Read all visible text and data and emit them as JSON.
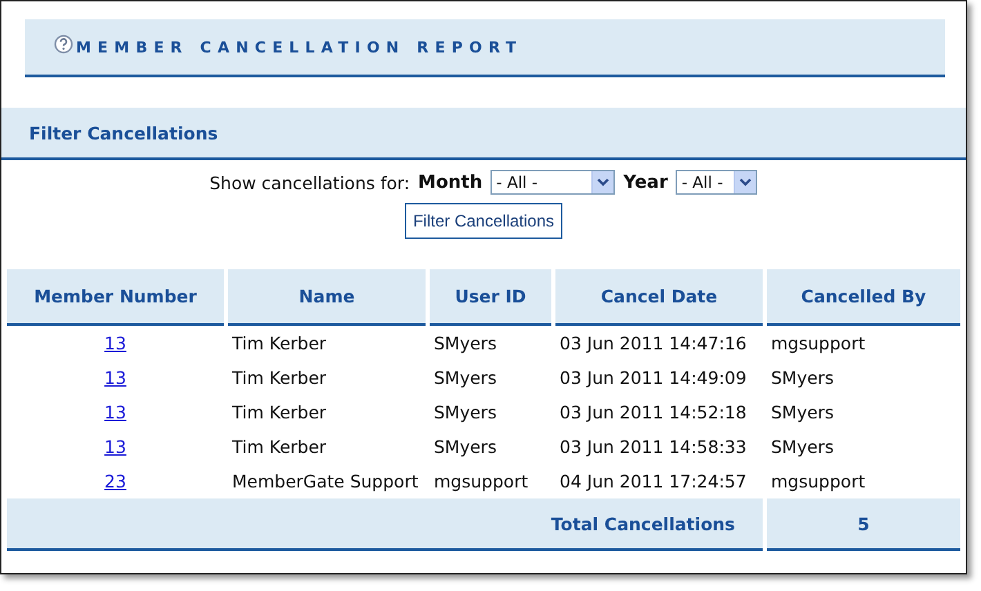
{
  "page_title": "MEMBER CANCELLATION REPORT",
  "filter": {
    "heading": "Filter Cancellations",
    "prompt": "Show cancellations for:",
    "month_label": "Month",
    "month_value": "- All -",
    "year_label": "Year",
    "year_value": "- All -",
    "button": "Filter Cancellations"
  },
  "table": {
    "columns": [
      "Member Number",
      "Name",
      "User ID",
      "Cancel Date",
      "Cancelled By"
    ],
    "rows": [
      {
        "member_number": "13",
        "name": "Tim Kerber",
        "user_id": "SMyers",
        "cancel_date": "03 Jun 2011 14:47:16",
        "cancelled_by": "mgsupport"
      },
      {
        "member_number": "13",
        "name": "Tim Kerber",
        "user_id": "SMyers",
        "cancel_date": "03 Jun 2011 14:49:09",
        "cancelled_by": "SMyers"
      },
      {
        "member_number": "13",
        "name": "Tim Kerber",
        "user_id": "SMyers",
        "cancel_date": "03 Jun 2011 14:52:18",
        "cancelled_by": "SMyers"
      },
      {
        "member_number": "13",
        "name": "Tim Kerber",
        "user_id": "SMyers",
        "cancel_date": "03 Jun 2011 14:58:33",
        "cancelled_by": "SMyers"
      },
      {
        "member_number": "23",
        "name": "MemberGate Support",
        "user_id": "mgsupport",
        "cancel_date": "04 Jun 2011 17:24:57",
        "cancelled_by": "mgsupport"
      }
    ],
    "total_label": "Total Cancellations",
    "total_value": "5"
  }
}
